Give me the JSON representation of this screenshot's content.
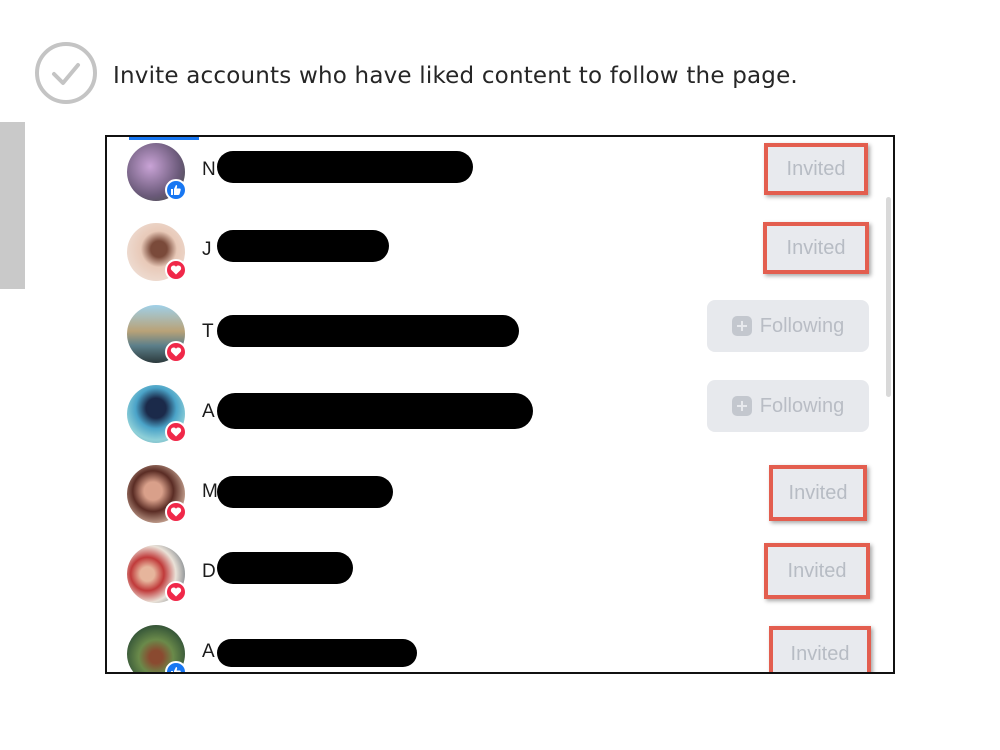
{
  "instruction": "Invite accounts who have liked content to follow the page.",
  "icons": {
    "check": "check-circle-icon",
    "like": "thumbs-up-icon",
    "love": "heart-icon",
    "following": "add-person-icon"
  },
  "colors": {
    "highlight": "#e35e4f",
    "like": "#1877f2",
    "love": "#f02849"
  },
  "rows": [
    {
      "initial": "N",
      "reaction": "like",
      "status": "Invited"
    },
    {
      "initial": "J",
      "reaction": "love",
      "status": "Invited"
    },
    {
      "initial": "T",
      "reaction": "love",
      "status": "Following"
    },
    {
      "initial": "A",
      "reaction": "love",
      "status": "Following"
    },
    {
      "initial": "M",
      "reaction": "love",
      "status": "Invited"
    },
    {
      "initial": "D",
      "reaction": "love",
      "status": "Invited"
    },
    {
      "initial": "A",
      "reaction": "like",
      "status": "Invited"
    }
  ]
}
